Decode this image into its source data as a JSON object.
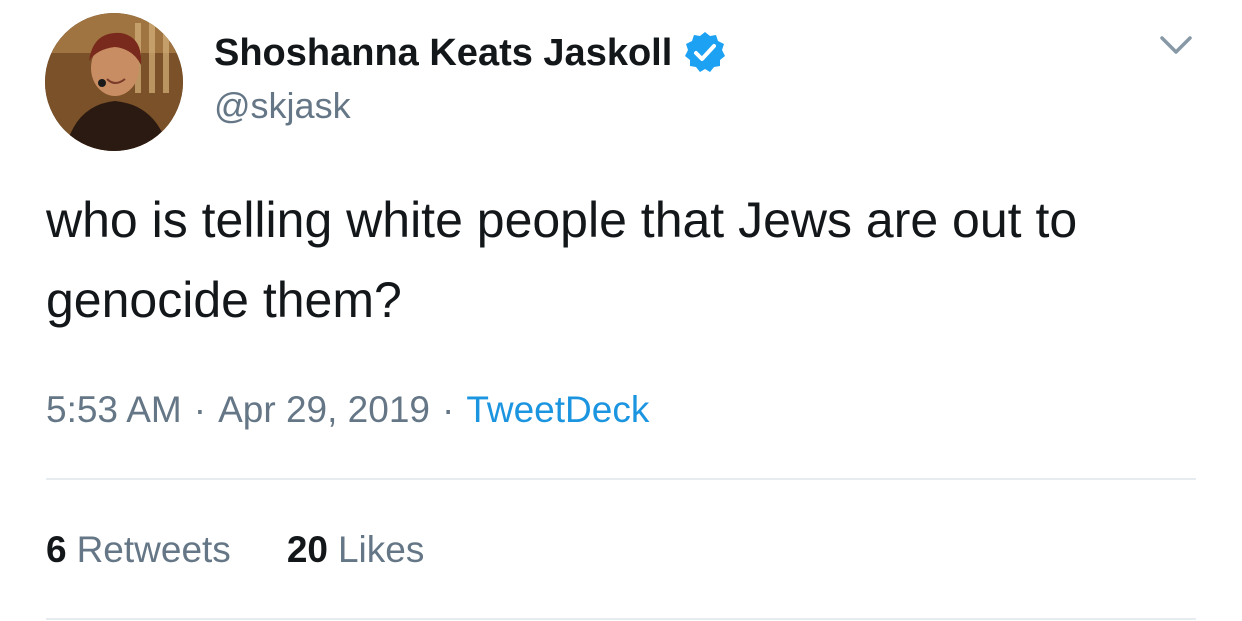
{
  "user": {
    "display_name": "Shoshanna Keats Jaskoll",
    "handle": "@skjask",
    "verified": true,
    "avatar_icon": "profile-photo"
  },
  "tweet": {
    "text": "who is telling white people that Jews are out to genocide them?",
    "time": "5:53 AM",
    "date": "Apr 29, 2019",
    "source": "TweetDeck",
    "separator": "·"
  },
  "stats": {
    "retweets_count": "6",
    "retweets_label": "Retweets",
    "likes_count": "20",
    "likes_label": "Likes"
  },
  "colors": {
    "text": "#14171a",
    "secondary": "#657786",
    "link": "#1b95e0",
    "verified": "#1da1f2",
    "divider": "#e6ecf0"
  },
  "icons": {
    "menu": "chevron-down-icon",
    "verified": "verified-badge-icon"
  }
}
